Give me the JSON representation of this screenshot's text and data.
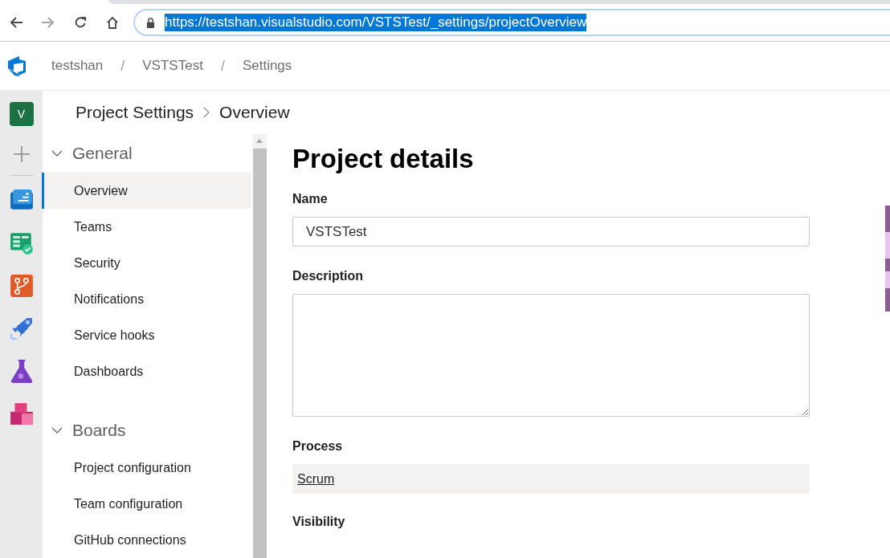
{
  "browser": {
    "nav_buttons": [
      {
        "kind": "back",
        "disabled": false
      },
      {
        "kind": "forward",
        "disabled": true
      },
      {
        "kind": "reload",
        "disabled": false
      },
      {
        "kind": "home",
        "disabled": false
      }
    ],
    "address": {
      "url": "https://testshan.visualstudio.com/VSTSTest/_settings/projectOverview",
      "selected": true
    }
  },
  "header": {
    "breadcrumb": [
      "testshan",
      "VSTSTest",
      "Settings"
    ],
    "separators": [
      "/",
      "/"
    ]
  },
  "rail": {
    "avatar": "V"
  },
  "page": {
    "breadcrumb": [
      "Project Settings",
      "Overview"
    ]
  },
  "nav": [
    {
      "title": "General",
      "expanded": true,
      "items": [
        {
          "label": "Overview",
          "selected": true
        },
        {
          "label": "Teams",
          "selected": false
        },
        {
          "label": "Security",
          "selected": false
        },
        {
          "label": "Notifications",
          "selected": false
        },
        {
          "label": "Service hooks",
          "selected": false
        },
        {
          "label": "Dashboards",
          "selected": false
        }
      ]
    },
    {
      "title": "Boards",
      "expanded": true,
      "items": [
        {
          "label": "Project configuration",
          "selected": false
        },
        {
          "label": "Team configuration",
          "selected": false
        },
        {
          "label": "GitHub connections",
          "selected": false
        }
      ]
    }
  ],
  "content": {
    "heading": "Project details",
    "fields": [
      {
        "kind": "text",
        "label": "Name",
        "value": "VSTSTest"
      },
      {
        "kind": "textarea",
        "label": "Description"
      },
      {
        "kind": "link",
        "label": "Process",
        "value": "Scrum"
      },
      {
        "kind": "heading",
        "label": "Visibility"
      }
    ]
  }
}
